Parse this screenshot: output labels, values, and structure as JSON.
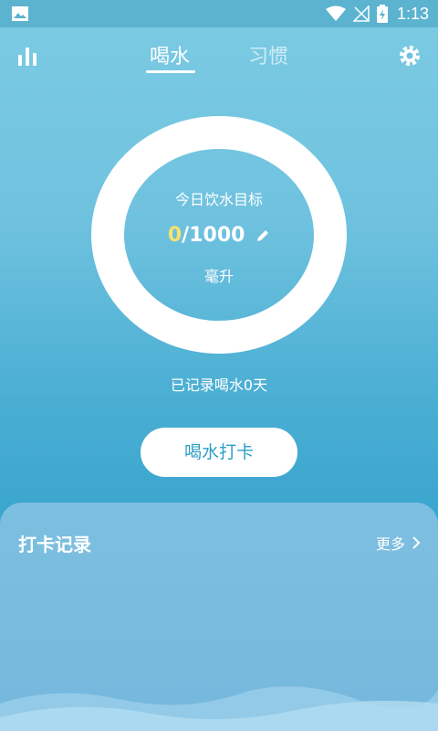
{
  "status_bar": {
    "time": "1:13",
    "icons": [
      "image-icon",
      "wifi-icon",
      "no-signal-icon",
      "battery-charging-icon"
    ]
  },
  "header": {
    "tabs": [
      {
        "label": "喝水",
        "active": true
      },
      {
        "label": "习惯",
        "active": false
      }
    ],
    "left_icon": "stats-icon",
    "right_icon": "settings-icon"
  },
  "goal": {
    "title": "今日饮水目标",
    "current": "0",
    "separator": "/",
    "target": "1000",
    "unit": "毫升"
  },
  "record_days_text": "已记录喝水0天",
  "checkin_button_label": "喝水打卡",
  "records": {
    "title": "打卡记录",
    "more_label": "更多"
  },
  "colors": {
    "accent_yellow": "#f7e26a",
    "button_text": "#2f9fc8"
  }
}
